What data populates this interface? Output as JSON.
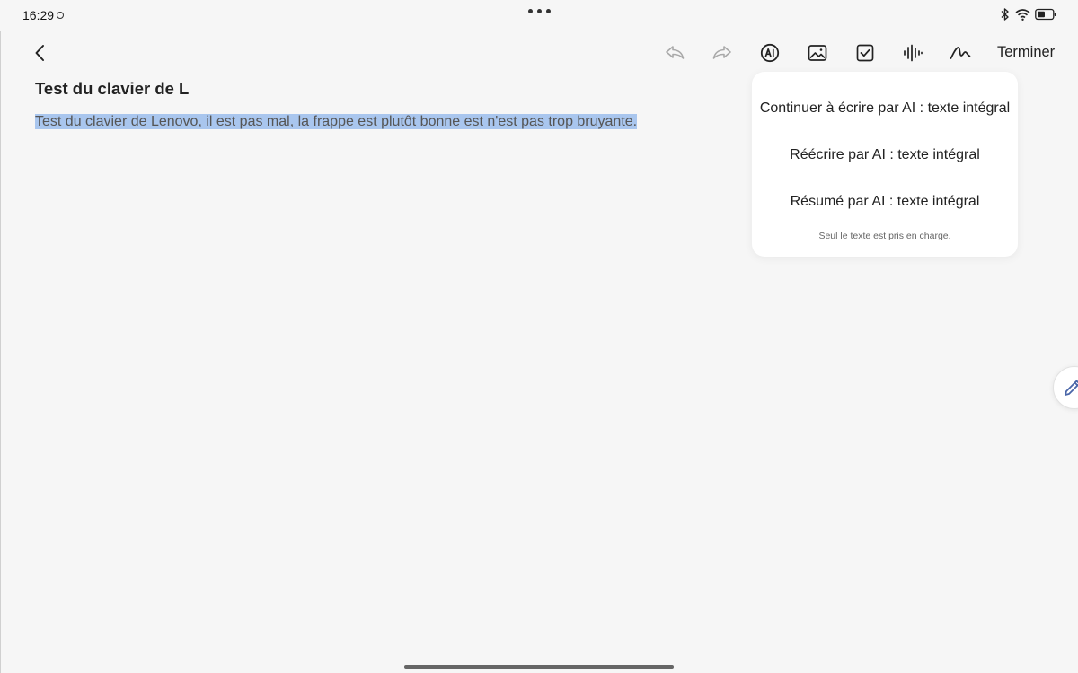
{
  "status_bar": {
    "time": "16:29",
    "icons": [
      "bluetooth-icon",
      "wifi-icon",
      "battery-icon"
    ]
  },
  "toolbar": {
    "back_icon": "chevron-left-icon",
    "tools": [
      "undo-icon",
      "redo-icon",
      "ai-icon",
      "image-icon",
      "checkbox-icon",
      "voice-icon",
      "handwriting-icon"
    ],
    "finish_label": "Terminer"
  },
  "note": {
    "title": "Test du clavier de L",
    "body": "Test du clavier de Lenovo, il est pas mal, la frappe est plutôt bonne est n'est pas trop bruyante."
  },
  "ai_menu": {
    "options": [
      "Continuer à écrire par AI : texte intégral",
      "Réécrire par AI : texte intégral",
      "Résumé par AI : texte intégral"
    ],
    "footnote": "Seul le texte est pris en charge."
  },
  "colors": {
    "background": "#f6f6f6",
    "selection": "#a9c6ee",
    "popup": "#ffffff"
  }
}
